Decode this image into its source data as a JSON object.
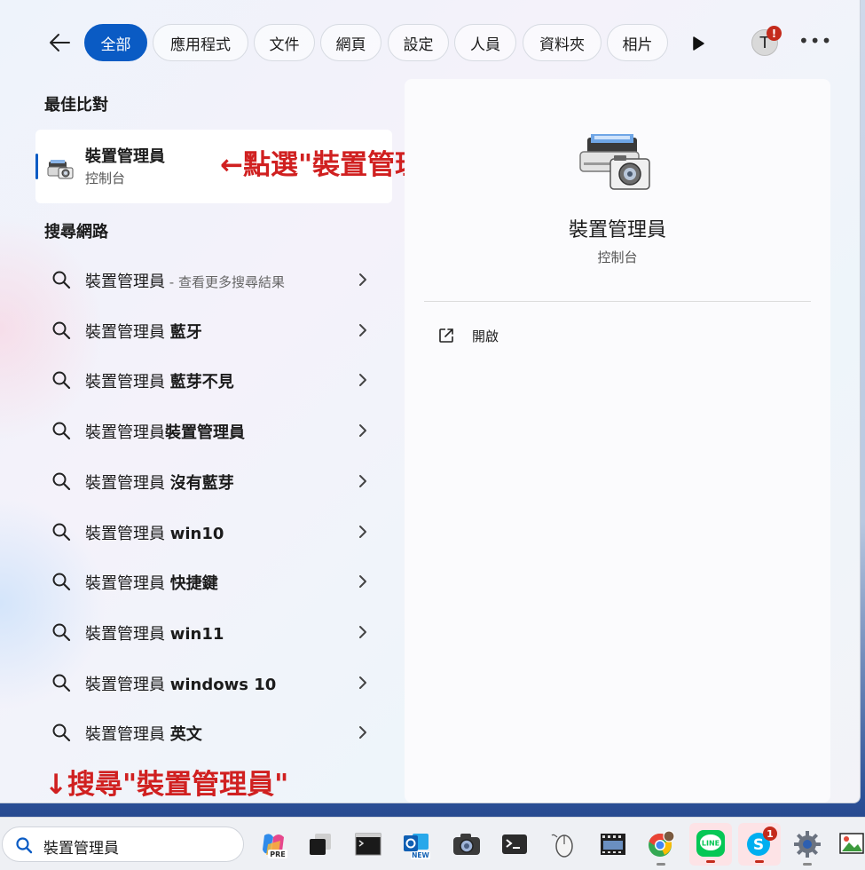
{
  "filters": {
    "back_label": "←",
    "tabs": [
      "全部",
      "應用程式",
      "文件",
      "網頁",
      "設定",
      "人員",
      "資料夾",
      "相片"
    ],
    "active_tab": "全部",
    "avatar_letter": "T",
    "avatar_badge": "!",
    "more_label": "•••"
  },
  "best_match": {
    "heading": "最佳比對",
    "name": "裝置管理員",
    "type": "控制台"
  },
  "annotations": {
    "click_hint": "←點選\"裝置管理員\"",
    "search_hint": "↓搜尋\"裝置管理員\""
  },
  "web_search": {
    "heading": "搜尋網路",
    "results": [
      {
        "query": "裝置管理員",
        "suffix": "",
        "hint": " - 查看更多搜尋結果"
      },
      {
        "query": "裝置管理員 ",
        "suffix": "藍牙",
        "hint": ""
      },
      {
        "query": "裝置管理員 ",
        "suffix": "藍芽不見",
        "hint": ""
      },
      {
        "query": "裝置管理員",
        "suffix": "裝置管理員",
        "hint": ""
      },
      {
        "query": "裝置管理員 ",
        "suffix": "沒有藍芽",
        "hint": ""
      },
      {
        "query": "裝置管理員 ",
        "suffix": "win10",
        "hint": ""
      },
      {
        "query": "裝置管理員 ",
        "suffix": "快捷鍵",
        "hint": ""
      },
      {
        "query": "裝置管理員 ",
        "suffix": "win11",
        "hint": ""
      },
      {
        "query": "裝置管理員 ",
        "suffix": "windows 10",
        "hint": ""
      },
      {
        "query": "裝置管理員 ",
        "suffix": "英文",
        "hint": ""
      }
    ]
  },
  "preview": {
    "name": "裝置管理員",
    "type": "控制台",
    "open_label": "開啟"
  },
  "taskbar": {
    "search_value": "裝置管理員",
    "copilot_label": "PRE",
    "outlook_label": "NEW",
    "line_label": "LINE",
    "skype_label": "S",
    "skype_badge": "1"
  },
  "colors": {
    "accent": "#0a5bc4",
    "annotation": "#d02020",
    "badge": "#c42b1c"
  }
}
